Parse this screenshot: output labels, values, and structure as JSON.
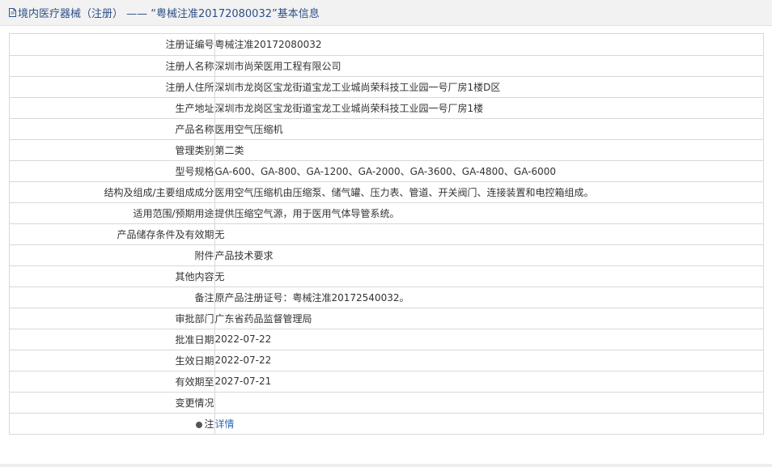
{
  "header": {
    "title": "境内医疗器械（注册） —— “粤械注准20172080032”基本信息"
  },
  "details": {
    "rows": [
      {
        "label": "注册证编号",
        "value": "粤械注准20172080032"
      },
      {
        "label": "注册人名称",
        "value": "深圳市尚荣医用工程有限公司"
      },
      {
        "label": "注册人住所",
        "value": "深圳市龙岗区宝龙街道宝龙工业城尚荣科技工业园一号厂房1楼D区"
      },
      {
        "label": "生产地址",
        "value": "深圳市龙岗区宝龙街道宝龙工业城尚荣科技工业园一号厂房1楼"
      },
      {
        "label": "产品名称",
        "value": "医用空气压缩机"
      },
      {
        "label": "管理类别",
        "value": "第二类"
      },
      {
        "label": "型号规格",
        "value": "GA-600、GA-800、GA-1200、GA-2000、GA-3600、GA-4800、GA-6000"
      },
      {
        "label": "结构及组成/主要组成成分",
        "value": "医用空气压缩机由压缩泵、储气罐、压力表、管道、开关阀门、连接装置和电控箱组成。"
      },
      {
        "label": "适用范围/预期用途",
        "value": "提供压缩空气源，用于医用气体导管系统。"
      },
      {
        "label": "产品储存条件及有效期",
        "value": "无"
      },
      {
        "label": "附件",
        "value": "产品技术要求"
      },
      {
        "label": "其他内容",
        "value": "无"
      },
      {
        "label": "备注",
        "value": "原产品注册证号：粤械注准20172540032。"
      },
      {
        "label": "审批部门",
        "value": "广东省药品监督管理局"
      },
      {
        "label": "批准日期",
        "value": "2022-07-22"
      },
      {
        "label": "生效日期",
        "value": "2022-07-22"
      },
      {
        "label": "有效期至",
        "value": "2027-07-21"
      },
      {
        "label": "变更情况",
        "value": ""
      }
    ],
    "note": {
      "label": "注",
      "link_text": "详情"
    }
  }
}
